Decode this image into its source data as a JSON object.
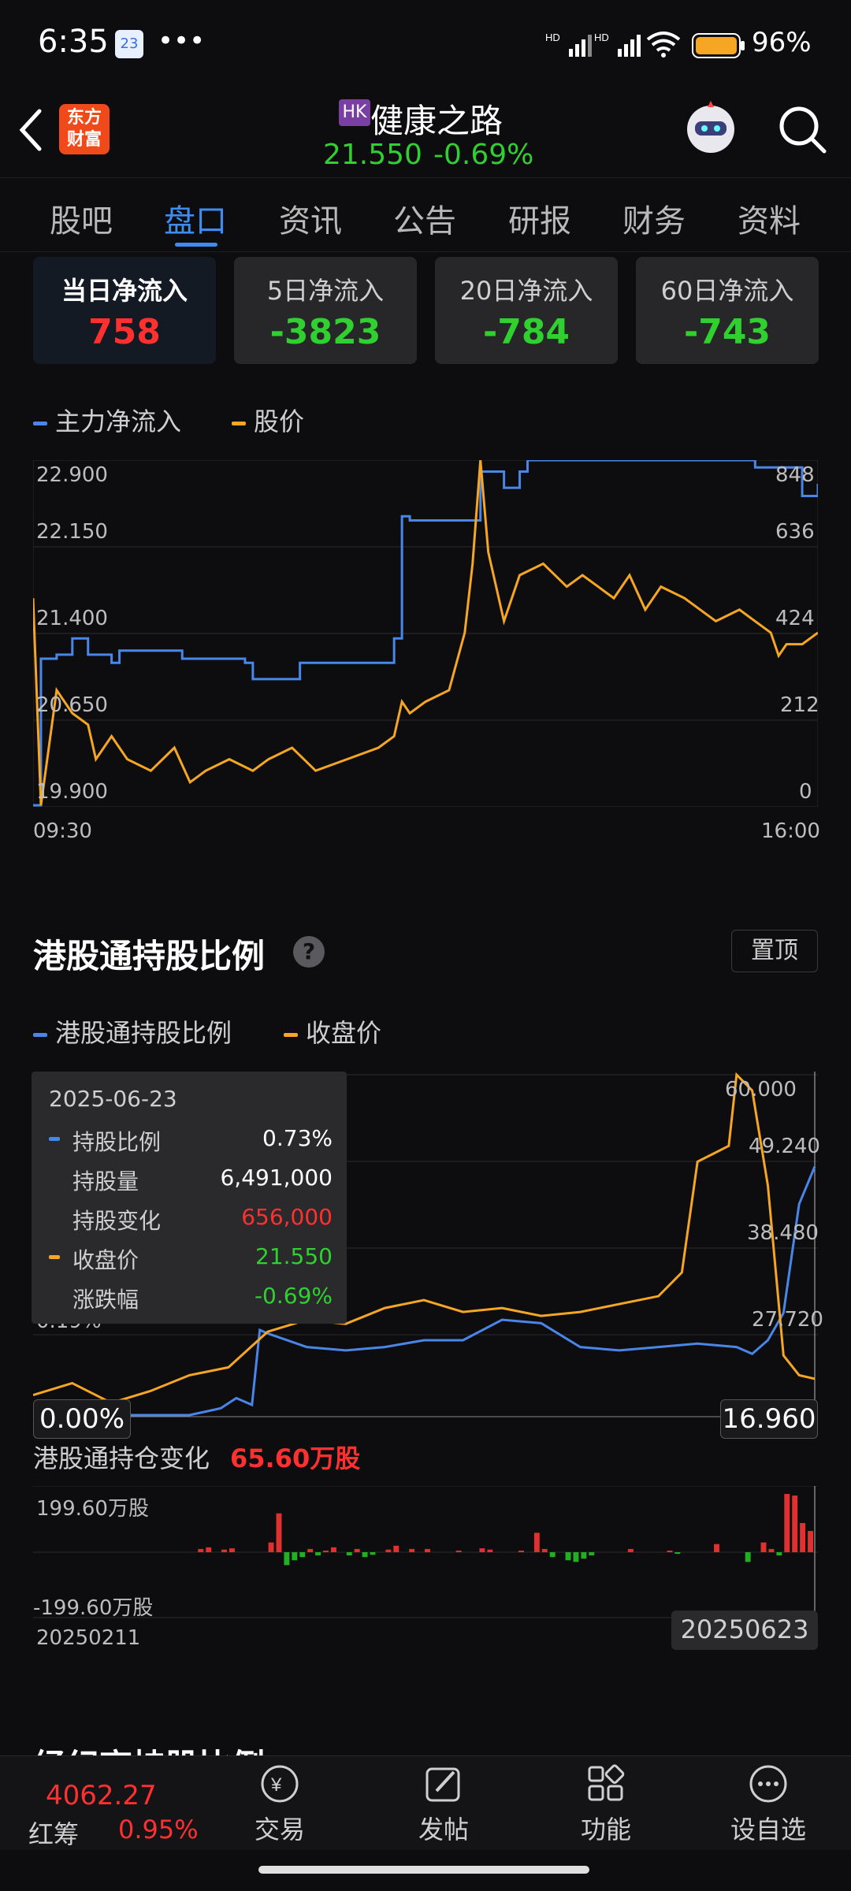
{
  "status_bar": {
    "time": "6:35",
    "battery": "96%",
    "notification_badge": "23"
  },
  "header": {
    "market_badge": "HK",
    "title": "健康之路",
    "price": "21.550",
    "change": "-0.69%",
    "logo_text": "东方财富"
  },
  "tabs": [
    "股吧",
    "盘口",
    "资讯",
    "公告",
    "研报",
    "财务",
    "资料"
  ],
  "active_tab": "盘口",
  "flow_cards": [
    {
      "label": "当日净流入",
      "value": "758",
      "color": "#ff3030"
    },
    {
      "label": "5日净流入",
      "value": "-3823",
      "color": "#2fd02f"
    },
    {
      "label": "20日净流入",
      "value": "-784",
      "color": "#2fd02f"
    },
    {
      "label": "60日净流入",
      "value": "-743",
      "color": "#2fd02f"
    }
  ],
  "flow_chart": {
    "legend": [
      {
        "name": "主力净流入",
        "color": "#4a86e8"
      },
      {
        "name": "股价",
        "color": "#f5a623"
      }
    ],
    "left_ticks": [
      "22.900",
      "22.150",
      "21.400",
      "20.650",
      "19.900"
    ],
    "right_ticks": [
      "848",
      "636",
      "424",
      "212",
      "0"
    ],
    "x_start": "09:30",
    "x_end": "16:00"
  },
  "hk_section": {
    "title": "港股通持股比例",
    "pin_label": "置顶",
    "legend": [
      {
        "name": "港股通持股比例",
        "color": "#4a86e8"
      },
      {
        "name": "收盘价",
        "color": "#f5a623"
      }
    ],
    "right_ticks": [
      "60.000",
      "49.240",
      "38.480",
      "27.720"
    ],
    "left_partial_ticks": [
      "0.19%"
    ],
    "left_badge": "0.00%",
    "right_badge": "16.960",
    "tooltip": {
      "date": "2025-06-23",
      "rows": [
        {
          "key": "持股比例",
          "value": "0.73%",
          "dot": "#4a86e8",
          "color": "#ffffff"
        },
        {
          "key": "持股量",
          "value": "6,491,000",
          "dot": "",
          "color": "#ffffff"
        },
        {
          "key": "持股变化",
          "value": "656,000",
          "dot": "",
          "color": "#ff3030"
        },
        {
          "key": "收盘价",
          "value": "21.550",
          "dot": "#f5a623",
          "color": "#2fd02f"
        },
        {
          "key": "涨跌幅",
          "value": "-0.69%",
          "dot": "",
          "color": "#2fd02f"
        }
      ]
    },
    "position_change_label": "港股通持仓变化",
    "position_change_value": "65.60万股",
    "bar_top_label": "199.60万股",
    "bar_bottom_label": "-199.60万股",
    "date_start": "20250211",
    "date_end": "20250623"
  },
  "next_section_title": "经纪商持股比例",
  "bottom_nav": {
    "index_value": "4062.27",
    "index_name": "红筹",
    "index_change": "0.95%",
    "items": [
      "交易",
      "发帖",
      "功能",
      "设自选"
    ]
  },
  "chart_data": [
    {
      "type": "line",
      "title": "",
      "x_range": [
        "09:30",
        "16:00"
      ],
      "series": [
        {
          "name": "主力净流入",
          "axis": "right",
          "ylim": [
            0,
            848
          ],
          "x": [
            0,
            0.01,
            0.03,
            0.05,
            0.07,
            0.1,
            0.11,
            0.14,
            0.19,
            0.27,
            0.28,
            0.34,
            0.46,
            0.47,
            0.48,
            0.56,
            0.57,
            0.6,
            0.62,
            0.63,
            0.9,
            0.92,
            0.95,
            0.98,
            1.0
          ],
          "y": [
            0,
            360,
            370,
            410,
            370,
            350,
            380,
            380,
            360,
            350,
            310,
            350,
            410,
            710,
            700,
            700,
            820,
            780,
            820,
            848,
            848,
            830,
            830,
            760,
            790
          ]
        },
        {
          "name": "股价",
          "axis": "left",
          "ylim": [
            19.9,
            22.9
          ],
          "x": [
            0,
            0.01,
            0.02,
            0.03,
            0.05,
            0.07,
            0.08,
            0.1,
            0.12,
            0.15,
            0.18,
            0.2,
            0.22,
            0.25,
            0.28,
            0.3,
            0.33,
            0.36,
            0.4,
            0.44,
            0.46,
            0.47,
            0.48,
            0.5,
            0.53,
            0.55,
            0.56,
            0.57,
            0.58,
            0.59,
            0.6,
            0.62,
            0.65,
            0.68,
            0.7,
            0.72,
            0.74,
            0.76,
            0.78,
            0.8,
            0.83,
            0.85,
            0.87,
            0.9,
            0.92,
            0.94,
            0.95,
            0.96,
            0.98,
            1.0
          ],
          "y": [
            21.7,
            19.9,
            20.4,
            20.9,
            20.7,
            20.6,
            20.3,
            20.5,
            20.3,
            20.2,
            20.4,
            20.1,
            20.2,
            20.3,
            20.2,
            20.3,
            20.4,
            20.2,
            20.3,
            20.4,
            20.5,
            20.8,
            20.7,
            20.8,
            20.9,
            21.4,
            22.0,
            22.9,
            22.1,
            21.8,
            21.5,
            21.9,
            22.0,
            21.8,
            21.9,
            21.8,
            21.7,
            21.9,
            21.6,
            21.8,
            21.7,
            21.6,
            21.5,
            21.6,
            21.5,
            21.4,
            21.2,
            21.3,
            21.3,
            21.4
          ]
        }
      ]
    },
    {
      "type": "line",
      "title": "港股通持股比例",
      "x_range": [
        "20250211",
        "20250623"
      ],
      "series": [
        {
          "name": "港股通持股比例",
          "ylim": [
            0,
            1.0
          ],
          "x": [
            0,
            0.1,
            0.2,
            0.24,
            0.26,
            0.28,
            0.29,
            0.3,
            0.35,
            0.4,
            0.45,
            0.5,
            0.55,
            0.6,
            0.65,
            0.7,
            0.75,
            0.8,
            0.85,
            0.9,
            0.92,
            0.94,
            0.96,
            0.98,
            1.0
          ],
          "y": [
            0.0,
            0.0,
            0.0,
            0.02,
            0.05,
            0.03,
            0.25,
            0.24,
            0.2,
            0.19,
            0.2,
            0.22,
            0.22,
            0.28,
            0.27,
            0.2,
            0.19,
            0.2,
            0.21,
            0.2,
            0.18,
            0.22,
            0.3,
            0.62,
            0.73
          ]
        },
        {
          "name": "收盘价",
          "ylim": [
            16.96,
            60.0
          ],
          "x": [
            0,
            0.05,
            0.1,
            0.15,
            0.2,
            0.25,
            0.3,
            0.35,
            0.4,
            0.45,
            0.5,
            0.55,
            0.6,
            0.65,
            0.7,
            0.75,
            0.8,
            0.83,
            0.85,
            0.87,
            0.89,
            0.9,
            0.92,
            0.94,
            0.96,
            0.98,
            1.0
          ],
          "y": [
            19.5,
            21.0,
            18.5,
            20.0,
            22.0,
            23.0,
            27.5,
            29.0,
            28.5,
            30.5,
            31.5,
            30.0,
            30.5,
            29.5,
            30.0,
            31.0,
            32.0,
            35.0,
            49.0,
            50.0,
            51.0,
            60.0,
            58.0,
            46.0,
            24.5,
            22.0,
            21.55
          ]
        }
      ]
    },
    {
      "type": "bar",
      "title": "港股通持仓变化",
      "ylim": [
        -199.6,
        199.6
      ],
      "x_range": [
        "20250211",
        "20250623"
      ],
      "values": [
        0,
        0,
        0,
        0,
        0,
        0,
        0,
        0,
        0,
        0,
        0,
        0,
        0,
        0,
        0,
        0,
        0,
        0,
        0,
        0,
        0,
        10,
        15,
        0,
        8,
        12,
        0,
        0,
        0,
        0,
        30,
        120,
        -40,
        -25,
        -15,
        10,
        -10,
        5,
        15,
        0,
        -10,
        10,
        -15,
        -8,
        0,
        8,
        20,
        0,
        10,
        0,
        10,
        0,
        0,
        0,
        5,
        0,
        0,
        12,
        8,
        0,
        0,
        0,
        5,
        0,
        60,
        10,
        -15,
        0,
        -25,
        -30,
        -20,
        -10,
        0,
        0,
        0,
        0,
        10,
        0,
        0,
        0,
        0,
        5,
        -5,
        0,
        0,
        0,
        0,
        25,
        0,
        0,
        0,
        -30,
        0,
        30,
        10,
        -10,
        180,
        175,
        90,
        65.6
      ]
    }
  ]
}
